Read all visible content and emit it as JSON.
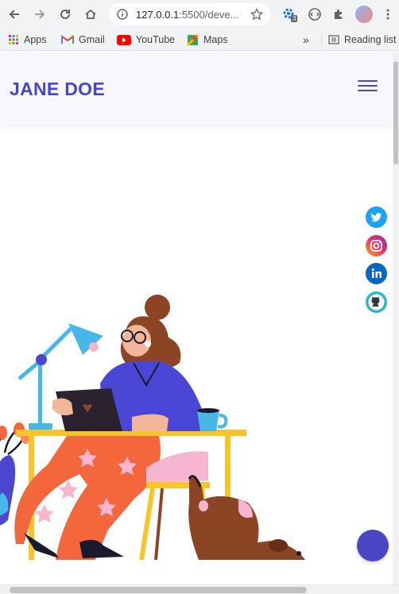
{
  "browser": {
    "url_host": "127.0.0.1",
    "url_rest": ":5500/deve...",
    "extension_badge": "3",
    "bookmarks": [
      {
        "label": "Apps"
      },
      {
        "label": "Gmail"
      },
      {
        "label": "YouTube"
      },
      {
        "label": "Maps"
      }
    ],
    "overflow_label": "»",
    "reading_list_label": "Reading list"
  },
  "site": {
    "logo": "JANE DOE"
  },
  "social": [
    {
      "icon": "twitter-icon",
      "color": "#1da1f2"
    },
    {
      "icon": "instagram-icon",
      "color": "#c13584"
    },
    {
      "icon": "linkedin-icon",
      "color": "#0a66c2"
    },
    {
      "icon": "github-icon",
      "color": "#2fb5c9"
    }
  ],
  "colors": {
    "brand": "#4845c8",
    "header_bg": "#f8f7fd",
    "desk": "#f7c52a",
    "shirt": "#4a47d6",
    "pants": "#f4663c"
  }
}
